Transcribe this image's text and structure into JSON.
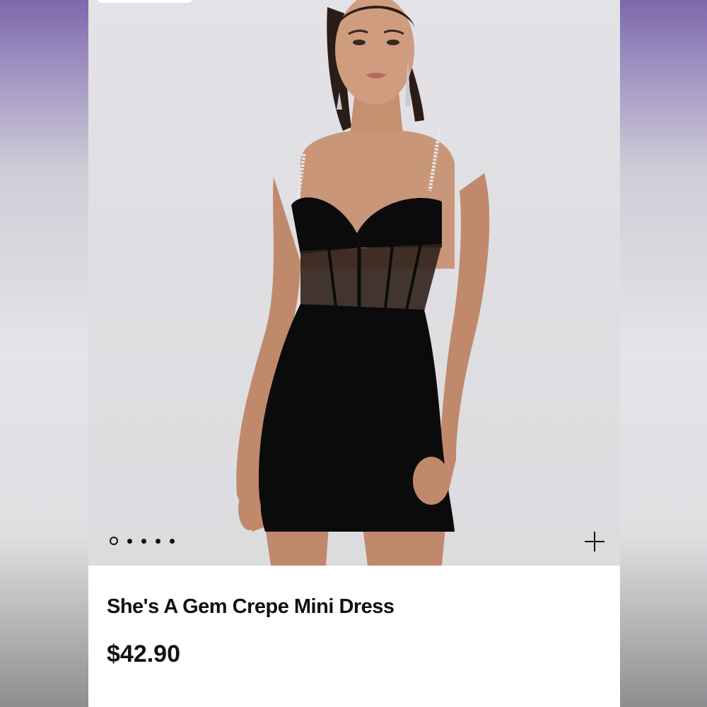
{
  "product": {
    "name": "She's A Gem Crepe Mini Dress",
    "price": "$42.90"
  },
  "gallery": {
    "image_count": 5,
    "active_index": 0,
    "add_icon": "plus-icon"
  },
  "colors": {
    "dress": "#0b0b0b",
    "skin": "#c99679",
    "background": "#e2e1e5",
    "side_accent": "#7d68ad"
  }
}
